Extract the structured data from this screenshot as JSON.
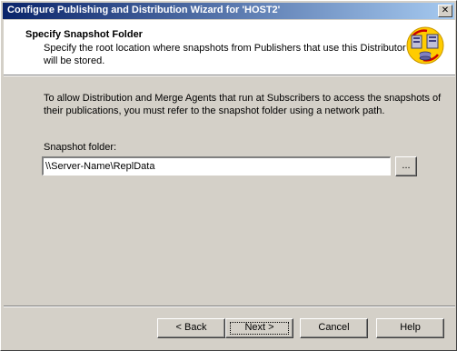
{
  "window": {
    "title": "Configure Publishing and Distribution Wizard for 'HOST2'",
    "close_glyph": "✕"
  },
  "header": {
    "title": "Specify Snapshot Folder",
    "description": "Specify the root location where snapshots from Publishers that use this Distributor will be stored.",
    "icon": "server-replication-icon"
  },
  "main": {
    "instructions": "To allow Distribution and Merge Agents that run at Subscribers to access the snapshots of their publications, you must refer to the snapshot folder using a network path.",
    "snapshot_folder_label": "Snapshot folder:",
    "snapshot_folder_value": "\\\\Server-Name\\ReplData",
    "browse_label": "..."
  },
  "footer": {
    "back_label": "< Back",
    "next_label": "Next >",
    "cancel_label": "Cancel",
    "help_label": "Help"
  },
  "colors": {
    "titlebar_start": "#0a246a",
    "titlebar_end": "#a6caf0",
    "face": "#d4d0c8",
    "header_bg": "#ffffff"
  }
}
